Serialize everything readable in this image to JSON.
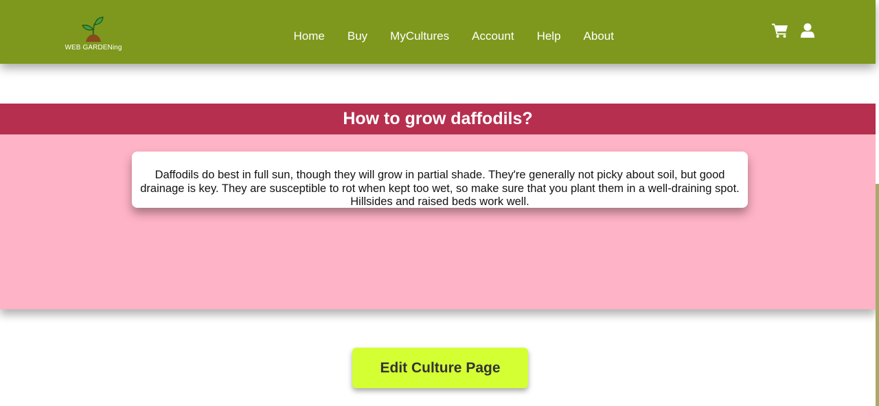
{
  "header": {
    "logo_text": "WEB GARDENing",
    "nav": [
      "Home",
      "Buy",
      "MyCultures",
      "Account",
      "Help",
      "About"
    ],
    "icons": [
      "shopping-cart-icon",
      "user-icon"
    ],
    "background": "#7e981d"
  },
  "section": {
    "title": "How to grow daffodils?",
    "title_bar_color": "#b72f4f",
    "body_color": "#ffb3c6",
    "description": "Daffodils do best in full sun, though they will grow in partial shade. They're generally not picky about soil, but good drainage is key. They are susceptible to rot when kept too wet, so make sure that you plant them in a well-draining spot. Hillsides and raised beds work well."
  },
  "actions": {
    "edit_label": "Edit Culture Page",
    "edit_color": "#d4ff33"
  }
}
